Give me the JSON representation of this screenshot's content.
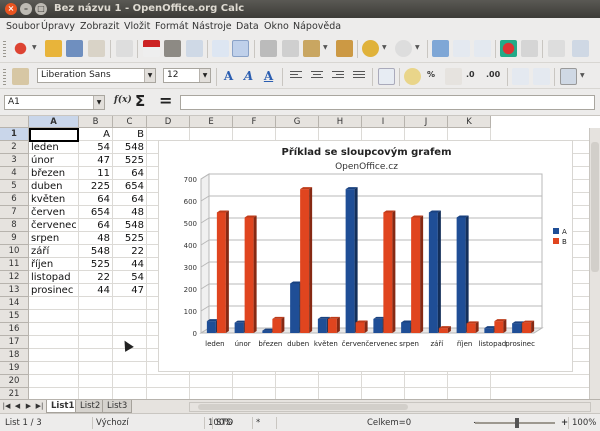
{
  "window": {
    "title": "Bez názvu 1 - OpenOffice.org Calc",
    "close_glyph": "×",
    "minimize_glyph": "–",
    "maximize_glyph": "□"
  },
  "menubar": [
    "Soubor",
    "Úpravy",
    "Zobrazit",
    "Vložit",
    "Formát",
    "Nástroje",
    "Data",
    "Okno",
    "Nápověda"
  ],
  "formatting": {
    "font_name": "Liberation Sans",
    "font_size": "12"
  },
  "formula_bar": {
    "name_box": "A1",
    "fx": "f(x)",
    "sigma": "Σ",
    "equals": "=",
    "formula": ""
  },
  "columns": [
    "A",
    "B",
    "C",
    "D",
    "E",
    "F",
    "G",
    "H",
    "I",
    "J",
    "K"
  ],
  "rows": [
    "1",
    "2",
    "3",
    "4",
    "5",
    "6",
    "7",
    "8",
    "9",
    "10",
    "11",
    "12",
    "13",
    "14",
    "15",
    "16",
    "17",
    "18",
    "19",
    "20",
    "21"
  ],
  "table": {
    "header": [
      "",
      "A",
      "B"
    ],
    "rows": [
      [
        "leden",
        "54",
        "548"
      ],
      [
        "únor",
        "47",
        "525"
      ],
      [
        "březen",
        "11",
        "64"
      ],
      [
        "duben",
        "225",
        "654"
      ],
      [
        "květen",
        "64",
        "64"
      ],
      [
        "červen",
        "654",
        "48"
      ],
      [
        "červenec",
        "64",
        "548"
      ],
      [
        "srpen",
        "48",
        "525"
      ],
      [
        "září",
        "548",
        "22"
      ],
      [
        "říjen",
        "525",
        "44"
      ],
      [
        "listopad",
        "22",
        "54"
      ],
      [
        "prosinec",
        "44",
        "47"
      ]
    ]
  },
  "chart_data": {
    "type": "bar",
    "title": "Příklad se sloupcovým grafem",
    "subtitle": "OpenOffice.cz",
    "categories": [
      "leden",
      "únor",
      "březen",
      "duben",
      "květen",
      "červen",
      "červenec",
      "srpen",
      "září",
      "říjen",
      "listopad",
      "prosinec"
    ],
    "series": [
      {
        "name": "A",
        "values": [
          54,
          47,
          11,
          225,
          64,
          654,
          64,
          48,
          548,
          525,
          22,
          44
        ],
        "color": "#1f4e96"
      },
      {
        "name": "B",
        "values": [
          548,
          525,
          64,
          654,
          64,
          48,
          548,
          525,
          22,
          44,
          54,
          47
        ],
        "color": "#e0451f"
      }
    ],
    "ylim": [
      0,
      700
    ],
    "yticks": [
      0,
      100,
      200,
      300,
      400,
      500,
      600,
      700
    ],
    "grid": true,
    "legend": "right",
    "style": "3d"
  },
  "sheet_tabs": [
    "List1",
    "List2",
    "List3"
  ],
  "active_sheet": "List1",
  "nav_buttons": [
    "|◀",
    "◀",
    "▶",
    "▶|"
  ],
  "statusbar": {
    "sheet": "List 1 / 3",
    "page_style": "Výchozí",
    "zoom_mode": "100%",
    "insert_mode": "STD",
    "selection": "*",
    "sum": "Celkem=0",
    "zoom": "100%",
    "zoom_minus": "−",
    "zoom_plus": "+"
  },
  "font_buttons": {
    "bold": "A",
    "italic": "A",
    "underline": "A"
  },
  "small_icons": {
    "percent": "%",
    "dec_add": ".0",
    "dec_del": ".00"
  }
}
